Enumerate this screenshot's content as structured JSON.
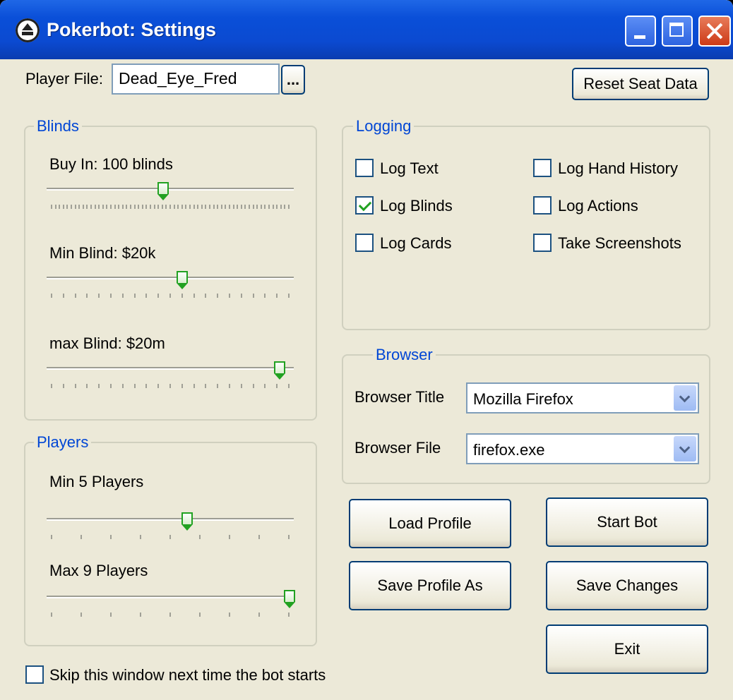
{
  "window": {
    "title": "Pokerbot: Settings"
  },
  "player_file": {
    "label": "Player File:",
    "value": "Dead_Eye_Fred",
    "browse_label": "..."
  },
  "reset_button": "Reset Seat Data",
  "blinds": {
    "title": "Blinds",
    "buy_in": {
      "label": "Buy In: 100 blinds",
      "fraction": 0.47
    },
    "min_blind": {
      "label": "Min Blind: $20k",
      "fraction": 0.55
    },
    "max_blind": {
      "label": "max Blind: $20m",
      "fraction": 0.96
    }
  },
  "players": {
    "title": "Players",
    "min": {
      "label": "Min 5 Players",
      "fraction": 0.57
    },
    "max": {
      "label": "Max 9 Players",
      "fraction": 1.0
    }
  },
  "logging": {
    "title": "Logging",
    "options": [
      {
        "label": "Log Text",
        "checked": false
      },
      {
        "label": "Log Hand History",
        "checked": false
      },
      {
        "label": "Log Blinds",
        "checked": true
      },
      {
        "label": "Log Actions",
        "checked": false
      },
      {
        "label": "Log Cards",
        "checked": false
      },
      {
        "label": "Take Screenshots",
        "checked": false
      }
    ]
  },
  "browser": {
    "title": "Browser",
    "title_label": "Browser Title",
    "title_value": "Mozilla Firefox",
    "file_label": "Browser File",
    "file_value": "firefox.exe"
  },
  "buttons": {
    "load_profile": "Load Profile",
    "start_bot": "Start Bot",
    "save_profile_as": "Save Profile As",
    "save_changes": "Save Changes",
    "exit": "Exit"
  },
  "skip": {
    "label": "Skip this window next time the bot starts",
    "checked": false
  },
  "colors": {
    "title_bar": "#0a4fd8",
    "group_title": "#0046d5",
    "check_mark": "#21a121"
  }
}
